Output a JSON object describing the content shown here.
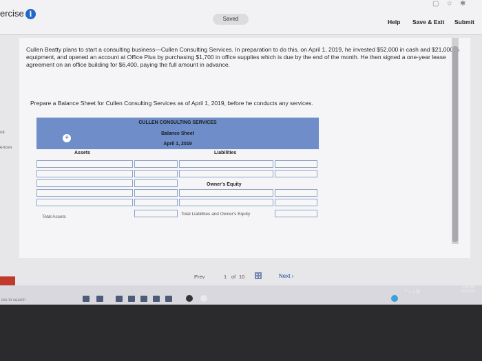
{
  "header": {
    "title": "ercise",
    "status": "Saved",
    "help": "Help",
    "save_exit": "Save & Exit",
    "submit": "Submit"
  },
  "problem": {
    "text": "Cullen Beatty plans to start a consulting business—Cullen Consulting Services. In preparation to do this, on April 1, 2019, he invested $52,000 in cash and $21,000 in equipment, and opened an account at Office Plus by purchasing $1,700 in office supplies which is due by the end of the month. He then signed a one-year lease agreement on an office building for $6,400, paying the full amount in advance.",
    "instruction": "Prepare a Balance Sheet for Cullen Consulting Services as of April 1, 2019, before he conducts any services."
  },
  "left_nav": [
    "ok",
    "ences"
  ],
  "balance_sheet": {
    "company": "CULLEN CONSULTING SERVICES",
    "statement": "Balance Sheet",
    "date": "April 1, 2019",
    "assets_header": "Assets",
    "liabilities_header": "Liabilities",
    "owners_equity_header": "Owner's Equity",
    "total_assets_label": "Total Assets",
    "total_liab_equity_label": "Total Liabilities and Owner's Equity"
  },
  "pager": {
    "prev": "Prev",
    "page": "1",
    "of": "of",
    "total": "10",
    "next": "Next"
  },
  "taskbar": {
    "search_placeholder": "ere to search"
  },
  "clock": {
    "time": "3:34 PM",
    "date": "4/2/2019"
  }
}
